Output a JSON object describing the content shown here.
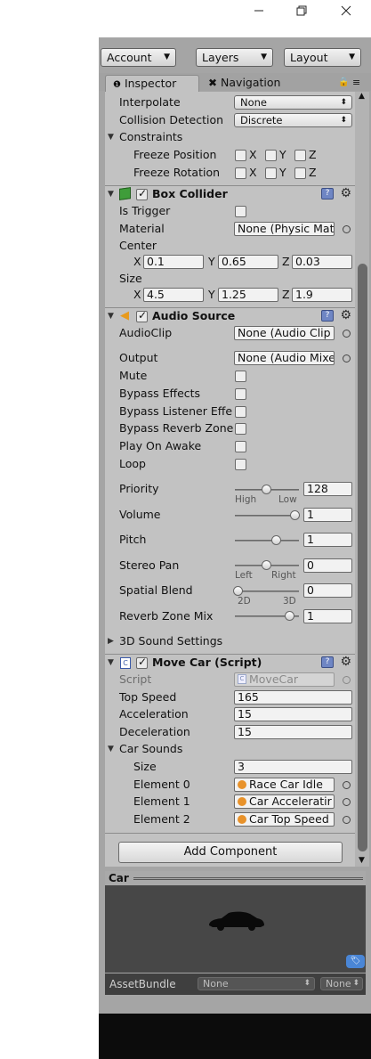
{
  "window": {
    "minimize_icon": "minimize-icon",
    "restore_icon": "restore-icon",
    "close_icon": "close-icon"
  },
  "toolbar": {
    "account": "Account",
    "layers": "Layers",
    "layout": "Layout"
  },
  "tabs": {
    "inspector": "Inspector",
    "navigation": "Navigation"
  },
  "rigidbody": {
    "interpolate_label": "Interpolate",
    "interpolate_value": "None",
    "collision_label": "Collision Detection",
    "collision_value": "Discrete",
    "constraints_label": "Constraints",
    "freeze_position_label": "Freeze Position",
    "freeze_rotation_label": "Freeze Rotation",
    "x": "X",
    "y": "Y",
    "z": "Z"
  },
  "box_collider": {
    "title": "Box Collider",
    "is_trigger_label": "Is Trigger",
    "material_label": "Material",
    "material_value": "None (Physic Mat",
    "center_label": "Center",
    "center": {
      "x": "0.1",
      "y": "0.65",
      "z": "0.03"
    },
    "size_label": "Size",
    "size": {
      "x": "4.5",
      "y": "1.25",
      "z": "1.9"
    }
  },
  "audio_source": {
    "title": "Audio Source",
    "audioclip_label": "AudioClip",
    "audioclip_value": "None (Audio Clip",
    "output_label": "Output",
    "output_value": "None (Audio Mixe",
    "mute_label": "Mute",
    "bypass_effects_label": "Bypass Effects",
    "bypass_listener_label": "Bypass Listener Effe",
    "bypass_reverb_label": "Bypass Reverb Zone",
    "play_on_awake_label": "Play On Awake",
    "loop_label": "Loop",
    "priority_label": "Priority",
    "priority_value": "128",
    "priority_high": "High",
    "priority_low": "Low",
    "volume_label": "Volume",
    "volume_value": "1",
    "pitch_label": "Pitch",
    "pitch_value": "1",
    "stereo_pan_label": "Stereo Pan",
    "stereo_pan_value": "0",
    "pan_left": "Left",
    "pan_right": "Right",
    "spatial_blend_label": "Spatial Blend",
    "spatial_blend_value": "0",
    "blend_2d": "2D",
    "blend_3d": "3D",
    "reverb_mix_label": "Reverb Zone Mix",
    "reverb_mix_value": "1",
    "sound_settings_label": "3D Sound Settings"
  },
  "move_car": {
    "title": "Move Car (Script)",
    "script_label": "Script",
    "script_value": "MoveCar",
    "top_speed_label": "Top Speed",
    "top_speed_value": "165",
    "acceleration_label": "Acceleration",
    "acceleration_value": "15",
    "deceleration_label": "Deceleration",
    "deceleration_value": "15",
    "car_sounds_label": "Car Sounds",
    "size_label": "Size",
    "size_value": "3",
    "elements": [
      {
        "label": "Element 0",
        "value": "Race Car Idle"
      },
      {
        "label": "Element 1",
        "value": "Car Acceleratir"
      },
      {
        "label": "Element 2",
        "value": "Car Top Speed"
      }
    ]
  },
  "add_component": "Add Component",
  "preview": {
    "title": "Car",
    "assetbundle_label": "AssetBundle",
    "bundle_name": "None",
    "bundle_variant": "None"
  }
}
